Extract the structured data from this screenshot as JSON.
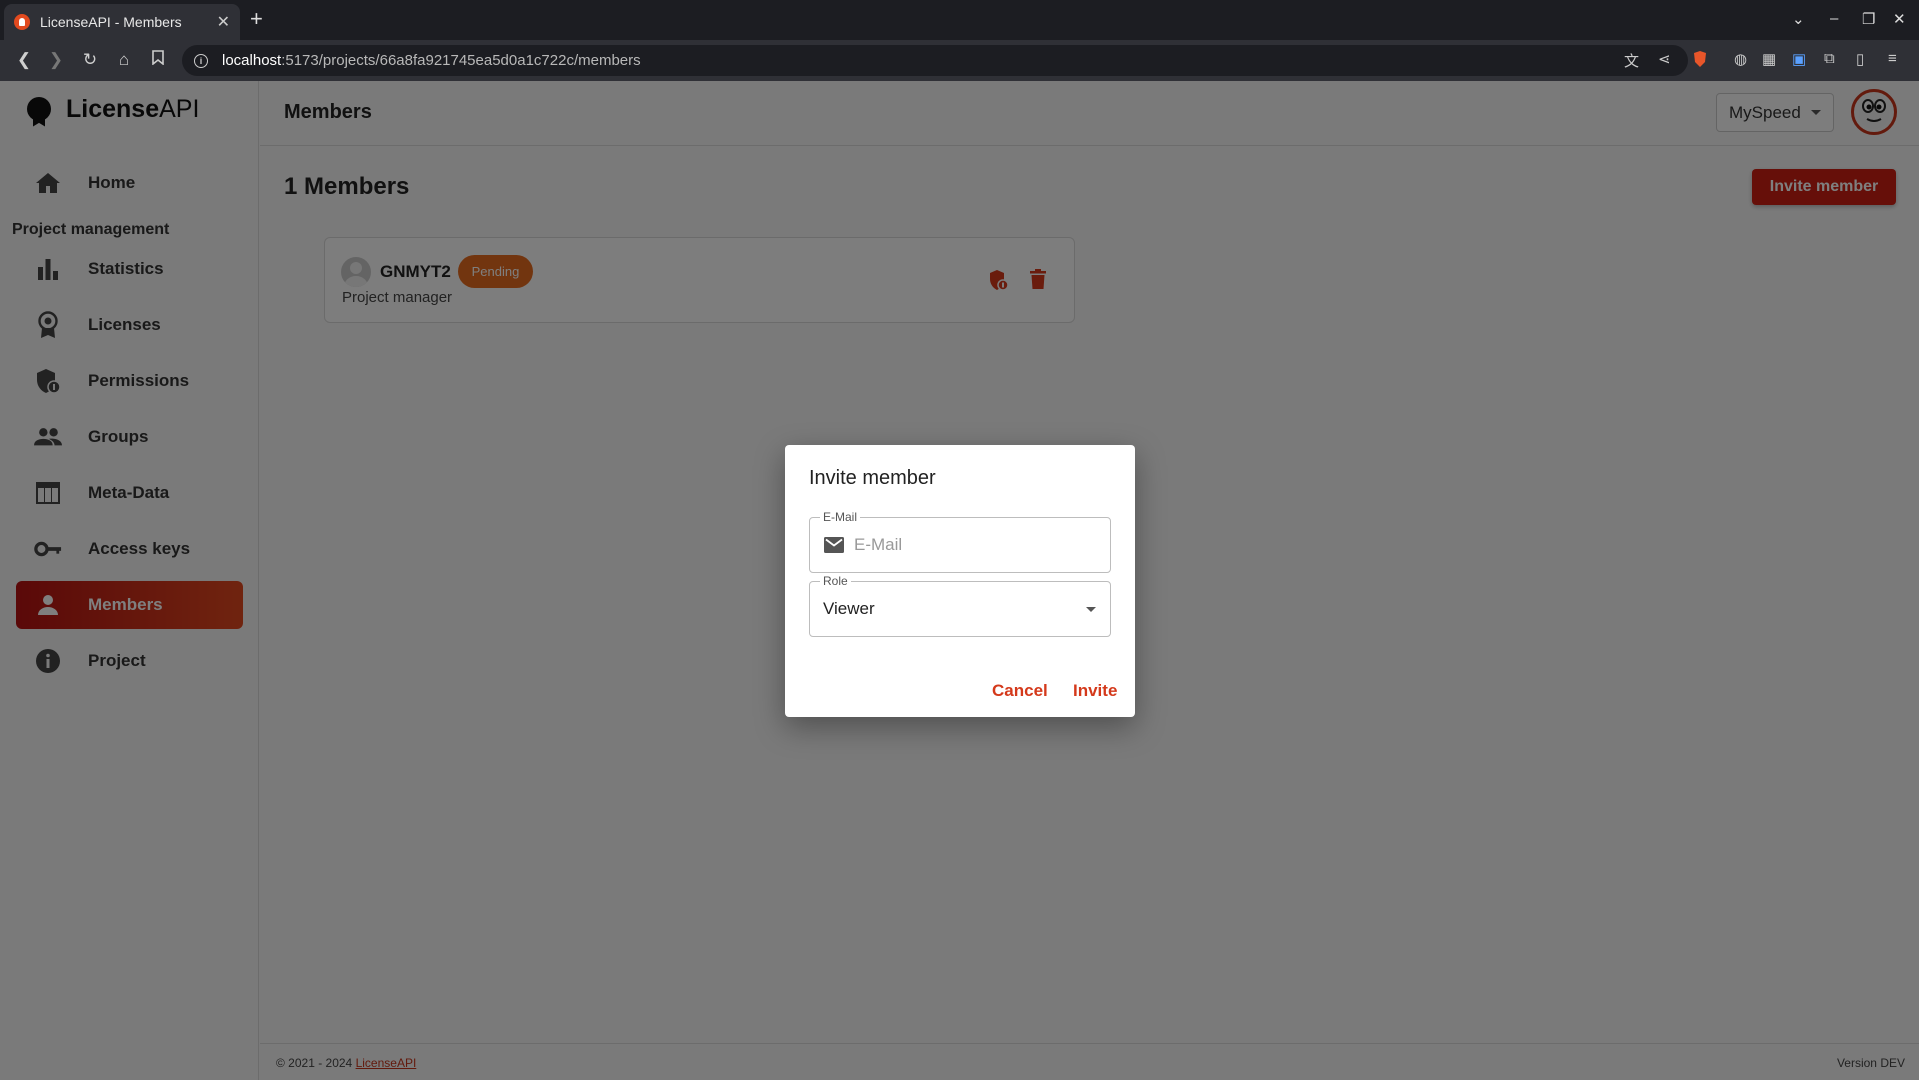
{
  "browser": {
    "tab_title": "LicenseAPI - Members",
    "tab_close": "✕",
    "new_tab": "+",
    "url_host": "localhost",
    "url_path": ":5173/projects/66a8fa921745ea5d0a1c722c/members"
  },
  "brand": {
    "bold": "License",
    "light": "API"
  },
  "sidebar": {
    "home": "Home",
    "section": "Project management",
    "items": [
      {
        "label": "Statistics",
        "icon": "bar-chart-icon"
      },
      {
        "label": "Licenses",
        "icon": "badge-icon"
      },
      {
        "label": "Permissions",
        "icon": "shield-icon"
      },
      {
        "label": "Groups",
        "icon": "people-icon"
      },
      {
        "label": "Meta-Data",
        "icon": "table-icon"
      },
      {
        "label": "Access keys",
        "icon": "key-icon"
      },
      {
        "label": "Members",
        "icon": "person-icon",
        "active": true
      },
      {
        "label": "Project",
        "icon": "info-icon"
      }
    ]
  },
  "header": {
    "title": "Members",
    "project": "MySpeed"
  },
  "main": {
    "count_title": "1 Members",
    "invite_button": "Invite member",
    "member": {
      "name": "GNMYT2",
      "status": "Pending",
      "role": "Project manager"
    }
  },
  "footer": {
    "copyright": "© 2021 - 2024 ",
    "link": "LicenseAPI",
    "version": "Version DEV"
  },
  "dialog": {
    "title": "Invite member",
    "email_label": "E-Mail",
    "email_placeholder": "E-Mail",
    "email_value": "",
    "role_label": "Role",
    "role_value": "Viewer",
    "cancel": "Cancel",
    "invite": "Invite"
  },
  "colors": {
    "accent": "#cc1e12",
    "accent_gradient_end": "#e0481f",
    "pending": "#e46a1e",
    "dialog_action": "#d4391b"
  }
}
